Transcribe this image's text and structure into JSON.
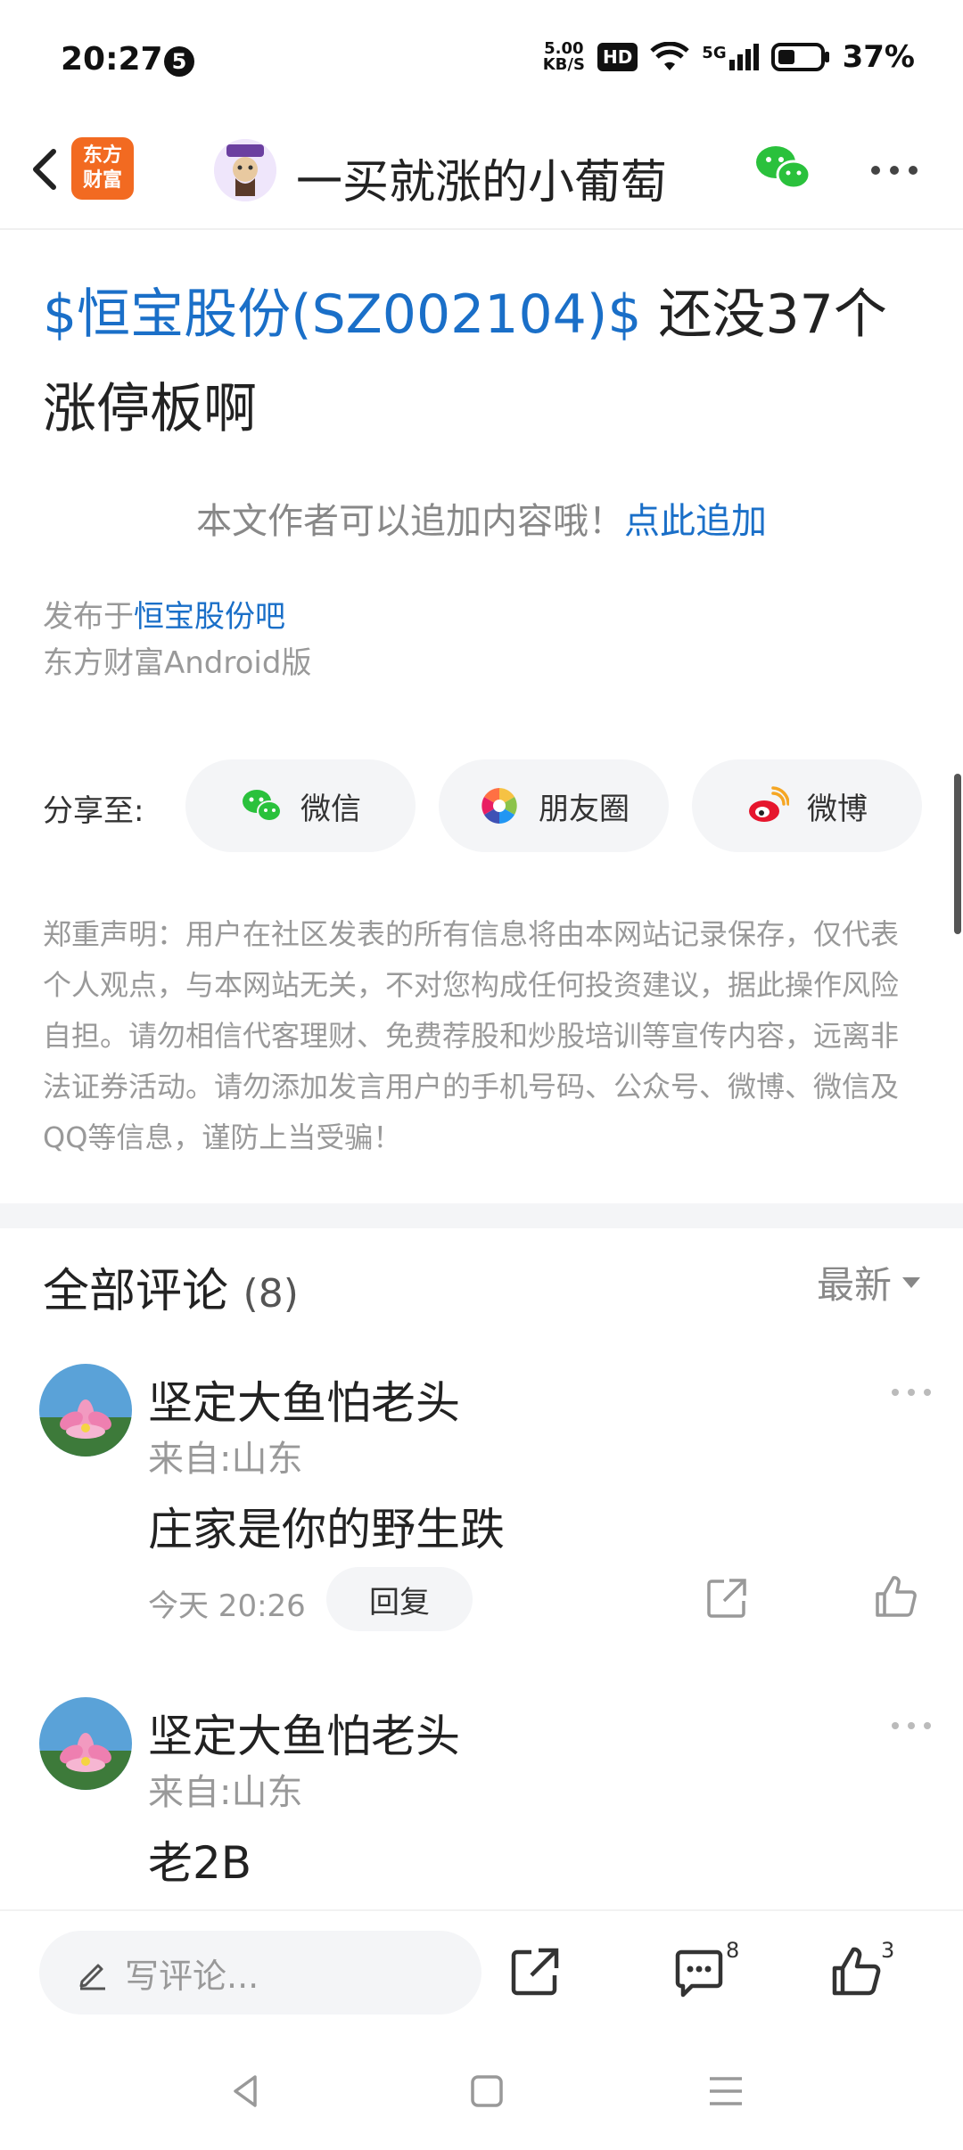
{
  "status_bar": {
    "time": "20:27",
    "notification_count": "5",
    "net_speed_value": "5.00",
    "net_speed_unit": "KB/S",
    "hd": "HD",
    "network": "5G",
    "battery": "37%"
  },
  "header": {
    "logo_line1": "东方",
    "logo_line2": "财富",
    "title": "一买就涨的小葡萄"
  },
  "post": {
    "title_stock": "$恒宝股份(SZ002104)$",
    "title_text": " 还没37个涨停板啊",
    "append_prompt": "本文作者可以追加内容哦！",
    "append_link": "点此追加",
    "posted_in_prefix": "发布于",
    "posted_in_forum": "恒宝股份吧",
    "client": "东方财富Android版"
  },
  "share": {
    "label": "分享至:",
    "wechat": "微信",
    "moments": "朋友圈",
    "weibo": "微博"
  },
  "disclaimer": "郑重声明：用户在社区发表的所有信息将由本网站记录保存，仅代表个人观点，与本网站无关，不对您构成任何投资建议，据此操作风险自担。请勿相信代客理财、免费荐股和炒股培训等宣传内容，远离非法证券活动。请勿添加发言用户的手机号码、公众号、微博、微信及QQ等信息，谨防上当受骗！",
  "comments": {
    "title": "全部评论",
    "count": "(8)",
    "sort": "最新",
    "items": [
      {
        "name": "坚定大鱼怕老头",
        "location": "来自:山东",
        "text": "庄家是你的野生跌",
        "time": "今天 20:26",
        "reply": "回复"
      },
      {
        "name": "坚定大鱼怕老头",
        "location": "来自:山东",
        "text": "老2B"
      }
    ]
  },
  "bottom_bar": {
    "write_placeholder": "写评论...",
    "comment_count": "8",
    "like_count": "3"
  },
  "colors": {
    "link_blue": "#1a6fc8",
    "brand_orange": "#f26a21"
  }
}
